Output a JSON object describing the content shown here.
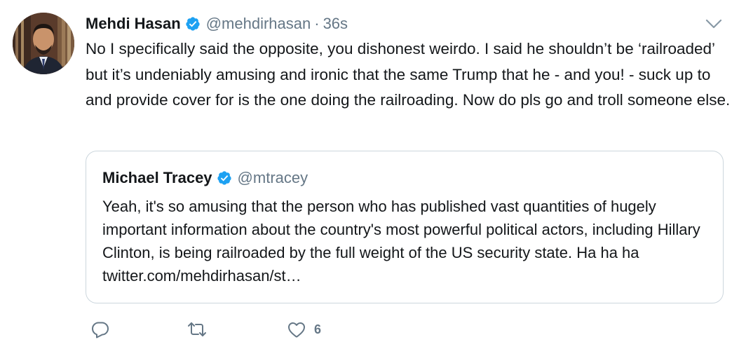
{
  "tweet": {
    "author_name": "Mehdi Hasan",
    "handle": "@mehdirhasan",
    "separator": "·",
    "timestamp": "36s",
    "text": "No I specifically said the opposite, you dishonest weirdo. I said he shouldn’t be ‘railroaded’ but it’s undeniably amusing and ironic that the same Trump that he - and you! - suck up to and provide cover for is the one doing the railroading. Now do pls go and troll someone else."
  },
  "quoted_tweet": {
    "author_name": "Michael Tracey",
    "handle": "@mtracey",
    "text": "Yeah, it's so amusing that the person who has published vast quantities of hugely important information about the country's most powerful political actors, including Hillary Clinton, is being railroaded by the full weight of the US security state. Ha ha ha twitter.com/mehdirhasan/st…"
  },
  "actions": {
    "reply_icon": "reply-icon",
    "retweet_icon": "retweet-icon",
    "like_icon": "heart-icon",
    "like_count": "6"
  },
  "colors": {
    "verified": "#1da1f2",
    "secondary_text": "#657786",
    "border": "#ccd6dd"
  }
}
